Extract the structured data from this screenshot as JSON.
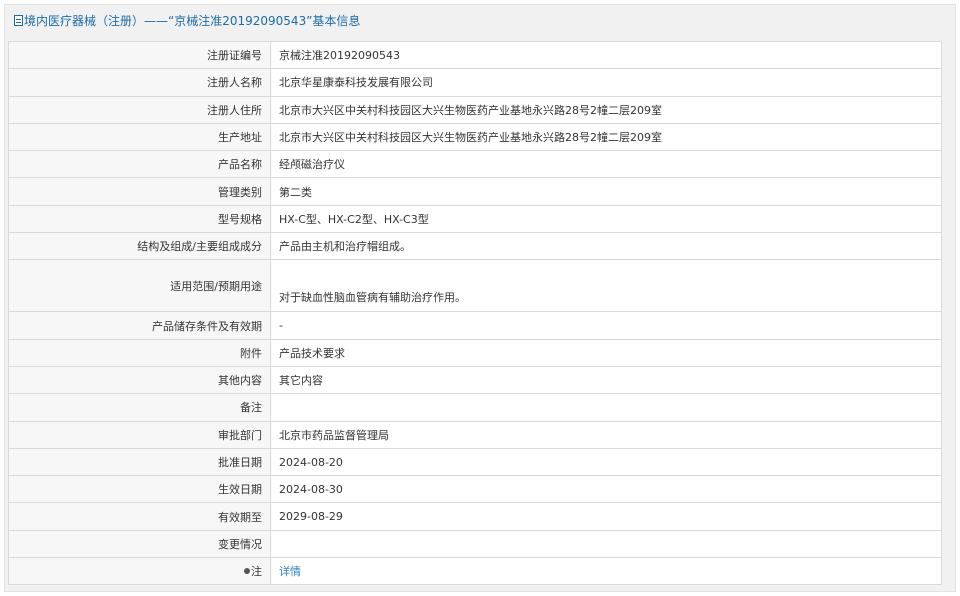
{
  "header": {
    "icon": "document-icon",
    "title": "境内医疗器械（注册）——“京械注准20192090543”基本信息"
  },
  "rows": [
    {
      "label": "注册证编号",
      "value": "京械注准20192090543"
    },
    {
      "label": "注册人名称",
      "value": "北京华星康泰科技发展有限公司"
    },
    {
      "label": "注册人住所",
      "value": "北京市大兴区中关村科技园区大兴生物医药产业基地永兴路28号2幢二层209室"
    },
    {
      "label": "生产地址",
      "value": "北京市大兴区中关村科技园区大兴生物医药产业基地永兴路28号2幢二层209室"
    },
    {
      "label": "产品名称",
      "value": "经颅磁治疗仪"
    },
    {
      "label": "管理类别",
      "value": "第二类"
    },
    {
      "label": "型号规格",
      "value": "HX-C型、HX-C2型、HX-C3型"
    },
    {
      "label": "结构及组成/主要组成成分",
      "value": "产品由主机和治疗帽组成。"
    },
    {
      "label": "适用范围/预期用途",
      "value": "对于缺血性脑血管病有辅助治疗作用。"
    },
    {
      "label": "产品储存条件及有效期",
      "value": "-"
    },
    {
      "label": "附件",
      "value": "产品技术要求"
    },
    {
      "label": "其他内容",
      "value": "其它内容"
    },
    {
      "label": "备注",
      "value": ""
    },
    {
      "label": "审批部门",
      "value": "北京市药品监督管理局"
    },
    {
      "label": "批准日期",
      "value": "2024-08-20"
    },
    {
      "label": "生效日期",
      "value": "2024-08-30"
    },
    {
      "label": "有效期至",
      "value": "2029-08-29"
    },
    {
      "label": "变更情况",
      "value": ""
    },
    {
      "label": "注",
      "value": "详情",
      "icon": "bullet-icon"
    }
  ],
  "colors": {
    "title": "#1d6aa8",
    "link": "#2a7fc4",
    "border": "#d9d9d9",
    "panel": "#f1f1f1"
  }
}
